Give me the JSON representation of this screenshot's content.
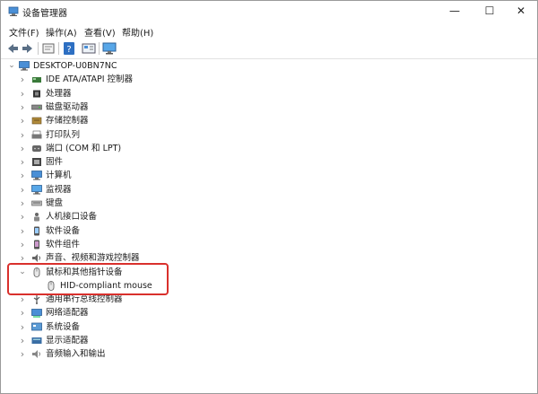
{
  "window": {
    "title": "设备管理器",
    "minimize_glyph": "—",
    "maximize_glyph": "☐",
    "close_glyph": "✕"
  },
  "menu": [
    "文件(F)",
    "操作(A)",
    "查看(V)",
    "帮助(H)"
  ],
  "toolbar": {
    "icons": [
      "back-arrow-icon",
      "forward-arrow-icon",
      "properties-icon",
      "help-icon",
      "view-icon",
      "monitor-icon"
    ]
  },
  "tree": {
    "root": {
      "label": "DESKTOP-U0BN7NC",
      "expanded": true
    },
    "items": [
      {
        "label": "IDE ATA/ATAPI 控制器",
        "icon": "ide-controller-icon"
      },
      {
        "label": "处理器",
        "icon": "processor-icon"
      },
      {
        "label": "磁盘驱动器",
        "icon": "disk-drive-icon"
      },
      {
        "label": "存储控制器",
        "icon": "storage-controller-icon"
      },
      {
        "label": "打印队列",
        "icon": "printer-icon"
      },
      {
        "label": "端口 (COM 和 LPT)",
        "icon": "port-icon"
      },
      {
        "label": "固件",
        "icon": "firmware-icon"
      },
      {
        "label": "计算机",
        "icon": "computer-icon"
      },
      {
        "label": "监视器",
        "icon": "monitor-icon"
      },
      {
        "label": "键盘",
        "icon": "keyboard-icon"
      },
      {
        "label": "人机接口设备",
        "icon": "hid-icon"
      },
      {
        "label": "软件设备",
        "icon": "software-device-icon"
      },
      {
        "label": "软件组件",
        "icon": "software-component-icon"
      },
      {
        "label": "声音、视频和游戏控制器",
        "icon": "sound-icon"
      },
      {
        "label": "鼠标和其他指针设备",
        "icon": "mouse-icon",
        "expanded": true,
        "children": [
          {
            "label": "HID-compliant mouse",
            "icon": "mouse-icon"
          }
        ]
      },
      {
        "label": "通用串行总线控制器",
        "icon": "usb-icon"
      },
      {
        "label": "网络适配器",
        "icon": "network-adapter-icon"
      },
      {
        "label": "系统设备",
        "icon": "system-device-icon"
      },
      {
        "label": "显示适配器",
        "icon": "display-adapter-icon"
      },
      {
        "label": "音频输入和输出",
        "icon": "audio-io-icon"
      }
    ]
  },
  "colors": {
    "highlight": "#d9302c",
    "chevron": "#7a7a7a"
  }
}
